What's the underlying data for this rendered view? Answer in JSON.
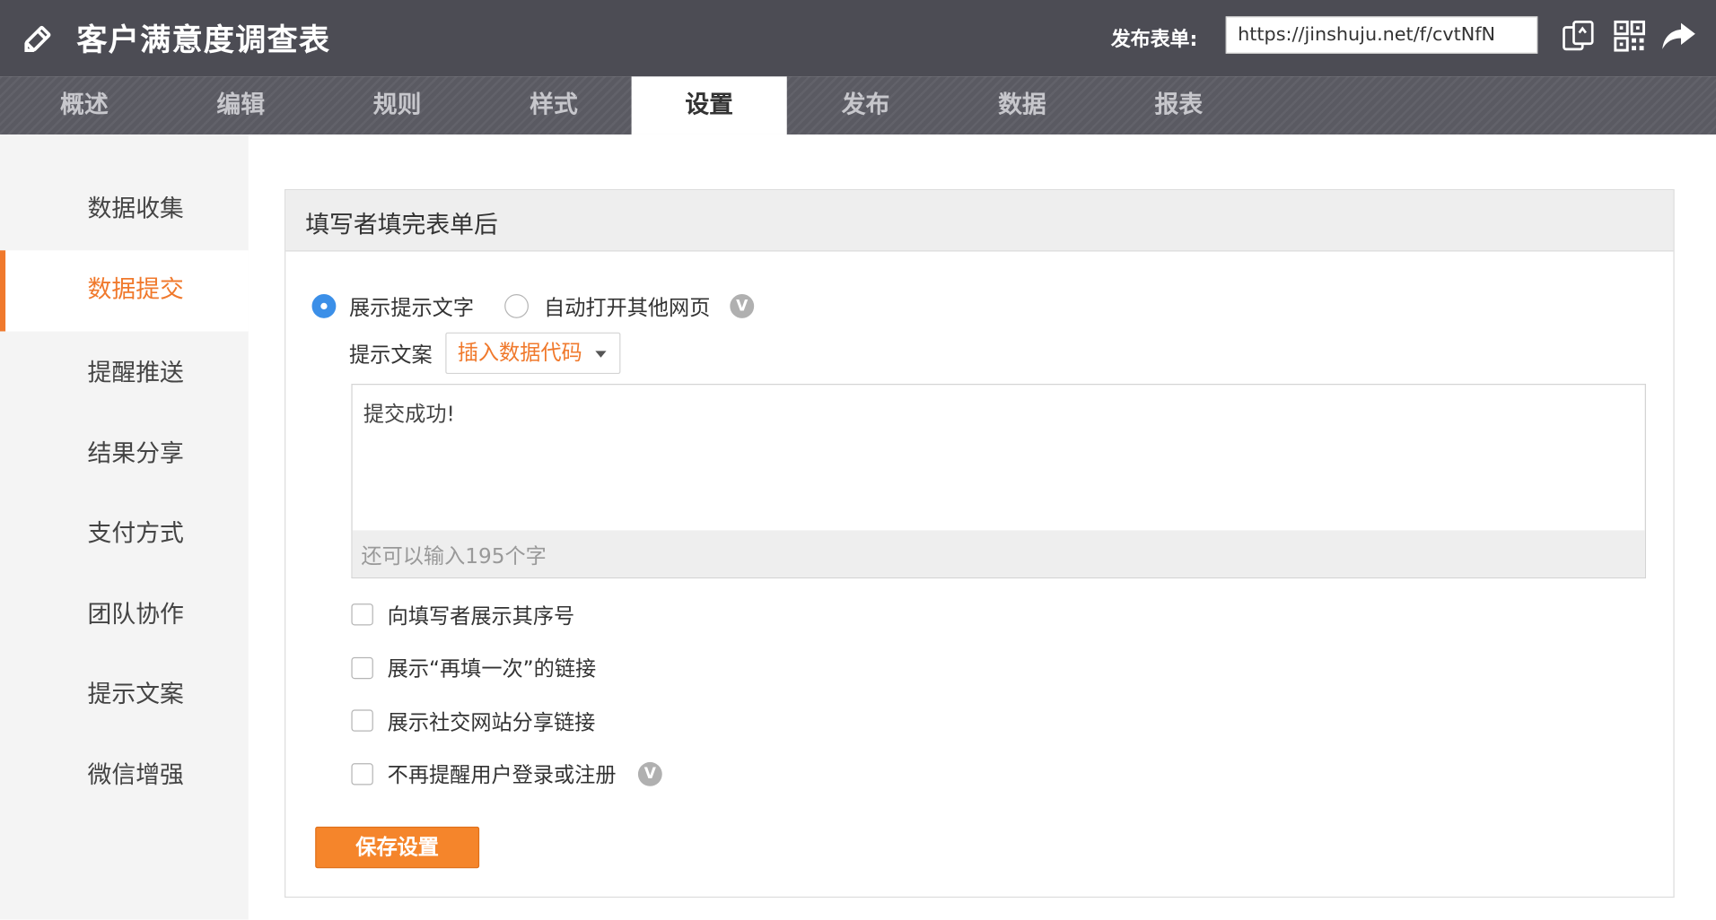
{
  "header": {
    "app_title": "客户满意度调查表",
    "publish_label": "发布表单:",
    "publish_url": "https://jinshuju.net/f/cvtNfN",
    "icons": [
      "pencil-icon",
      "copy-icon",
      "qrcode-icon",
      "share-icon"
    ]
  },
  "tabs": [
    {
      "label": "概述",
      "active": false
    },
    {
      "label": "编辑",
      "active": false
    },
    {
      "label": "规则",
      "active": false
    },
    {
      "label": "样式",
      "active": false
    },
    {
      "label": "设置",
      "active": true
    },
    {
      "label": "发布",
      "active": false
    },
    {
      "label": "数据",
      "active": false
    },
    {
      "label": "报表",
      "active": false
    }
  ],
  "sidebar": {
    "items": [
      {
        "label": "数据收集",
        "active": false
      },
      {
        "label": "数据提交",
        "active": true
      },
      {
        "label": "提醒推送",
        "active": false
      },
      {
        "label": "结果分享",
        "active": false
      },
      {
        "label": "支付方式",
        "active": false
      },
      {
        "label": "团队协作",
        "active": false
      },
      {
        "label": "提示文案",
        "active": false
      },
      {
        "label": "微信增强",
        "active": false
      }
    ]
  },
  "panel": {
    "title": "填写者填完表单后",
    "radio_show_text": "展示提示文字",
    "radio_redirect": "自动打开其他网页",
    "help_glyph": "V",
    "prompt_label": "提示文案",
    "insert_code_label": "插入数据代码",
    "textarea_value": "提交成功!",
    "char_counter": "还可以输入195个字",
    "checkboxes": [
      {
        "label": "向填写者展示其序号",
        "checked": false
      },
      {
        "label": "展示“再填一次”的链接",
        "checked": false
      },
      {
        "label": "展示社交网站分享链接",
        "checked": false
      },
      {
        "label": "不再提醒用户登录或注册",
        "checked": false
      }
    ],
    "save_label": "保存设置"
  },
  "colors": {
    "accent": "#f0792c",
    "topbar": "#4c4c54",
    "radio_active": "#3b8fe8"
  }
}
